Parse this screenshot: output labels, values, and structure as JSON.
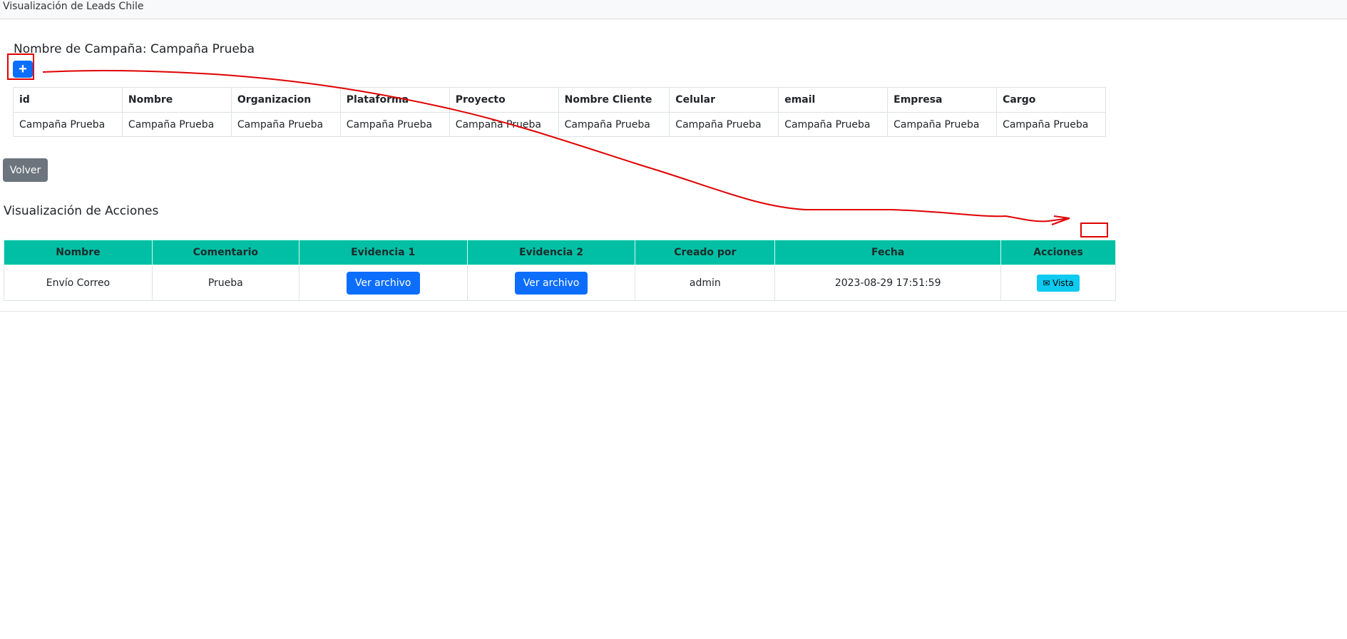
{
  "navbar": {
    "title": "Visualización de Leads Chile"
  },
  "campaign": {
    "heading": "Nombre de Campaña: Campaña Prueba",
    "add_label": "+",
    "headers": [
      "id",
      "Nombre",
      "Organizacion",
      "Plataforma",
      "Proyecto",
      "Nombre Cliente",
      "Celular",
      "email",
      "Empresa",
      "Cargo"
    ],
    "rows": [
      [
        "Campaña Prueba",
        "Campaña Prueba",
        "Campaña Prueba",
        "Campaña Prueba",
        "Campaña Prueba",
        "Campaña Prueba",
        "Campaña Prueba",
        "Campaña Prueba",
        "Campaña Prueba",
        "Campaña Prueba"
      ]
    ]
  },
  "volver_label": "Volver",
  "actions": {
    "heading": "Visualización de Acciones",
    "headers": [
      "Nombre",
      "Comentario",
      "Evidencia 1",
      "Evidencia 2",
      "Creado por",
      "Fecha",
      "Acciones"
    ],
    "rows": [
      {
        "nombre": "Envío Correo",
        "comentario": "Prueba",
        "evidencia1": "Ver archivo",
        "evidencia2": "Ver archivo",
        "creado_por": "admin",
        "fecha": "2023-08-29 17:51:59",
        "accion": "Vista"
      }
    ]
  },
  "colors": {
    "header_teal": "#00bfa5",
    "primary": "#0d6efd",
    "info": "#0dcaf0",
    "annotation": "#e00000"
  }
}
